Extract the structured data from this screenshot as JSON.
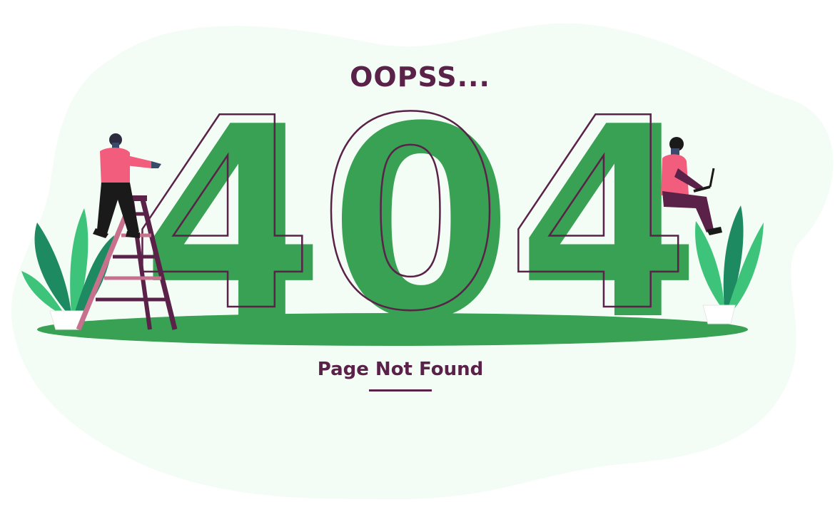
{
  "heading": "OOPSS...",
  "code": "404",
  "message": "Page Not Found",
  "colors": {
    "background_blob": "#f4fdf5",
    "digit_fill": "#38a153",
    "outline": "#5a2149",
    "ground": "#38a153",
    "text": "#5a2149",
    "shirt": "#f25c7d",
    "plant_dark": "#1e8a62",
    "plant_light": "#3ec47a"
  }
}
